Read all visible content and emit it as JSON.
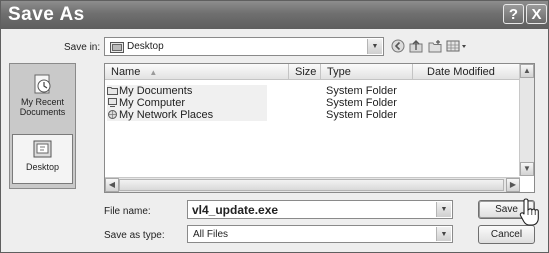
{
  "window": {
    "title": "Save As",
    "help_glyph": "?",
    "close_glyph": "X"
  },
  "save_in": {
    "label": "Save in:",
    "value": "Desktop"
  },
  "toolbar": {
    "icons": [
      "back-icon",
      "up-folder-icon",
      "new-folder-icon",
      "views-menu-icon"
    ]
  },
  "places_bar": {
    "items": [
      {
        "label": "My Recent Documents",
        "icon": "recent-documents-icon",
        "selected": false
      },
      {
        "label": "Desktop",
        "icon": "desktop-icon",
        "selected": true
      }
    ]
  },
  "file_list": {
    "columns": [
      "Name",
      "Size",
      "Type",
      "Date Modified"
    ],
    "rows": [
      {
        "name": "My Documents",
        "type": "System Folder",
        "icon": "documents-folder-icon"
      },
      {
        "name": "My Computer",
        "type": "System Folder",
        "icon": "computer-icon"
      },
      {
        "name": "My Network Places",
        "type": "System Folder",
        "icon": "network-places-icon"
      }
    ]
  },
  "file_name": {
    "label": "File name:",
    "value": "vl4_update.exe"
  },
  "save_as_type": {
    "label": "Save as type:",
    "value": "All Files"
  },
  "buttons": {
    "save": "Save",
    "cancel": "Cancel"
  }
}
